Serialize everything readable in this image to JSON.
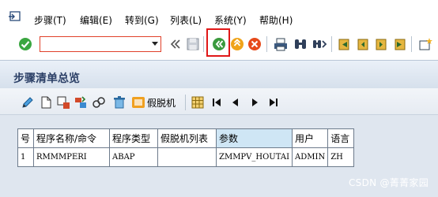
{
  "menu": {
    "items": [
      "步骤(T)",
      "编辑(E)",
      "转到(G)",
      "列表(L)",
      "系统(Y)",
      "帮助(H)"
    ]
  },
  "command_field": {
    "value": "",
    "placeholder": ""
  },
  "page": {
    "title": "步骤清单总览"
  },
  "app_toolbar": {
    "fake_machine_label": "假脱机"
  },
  "table": {
    "headers": [
      "号",
      "程序名称/命令",
      "程序类型",
      "假脱机列表",
      "参数",
      "用户",
      "语言"
    ],
    "rows": [
      [
        "1",
        "RMMMPERI",
        "ABAP",
        "",
        "ZMMPV_HOUTAI",
        "ADMIN",
        "ZH"
      ]
    ]
  },
  "watermark": "CSDN @菁菁家园",
  "colors": {
    "highlight": "#e01818",
    "title_text": "#2b3f66",
    "content_bg": "#dfe6ef",
    "param_header_bg": "#cfe6f5"
  }
}
